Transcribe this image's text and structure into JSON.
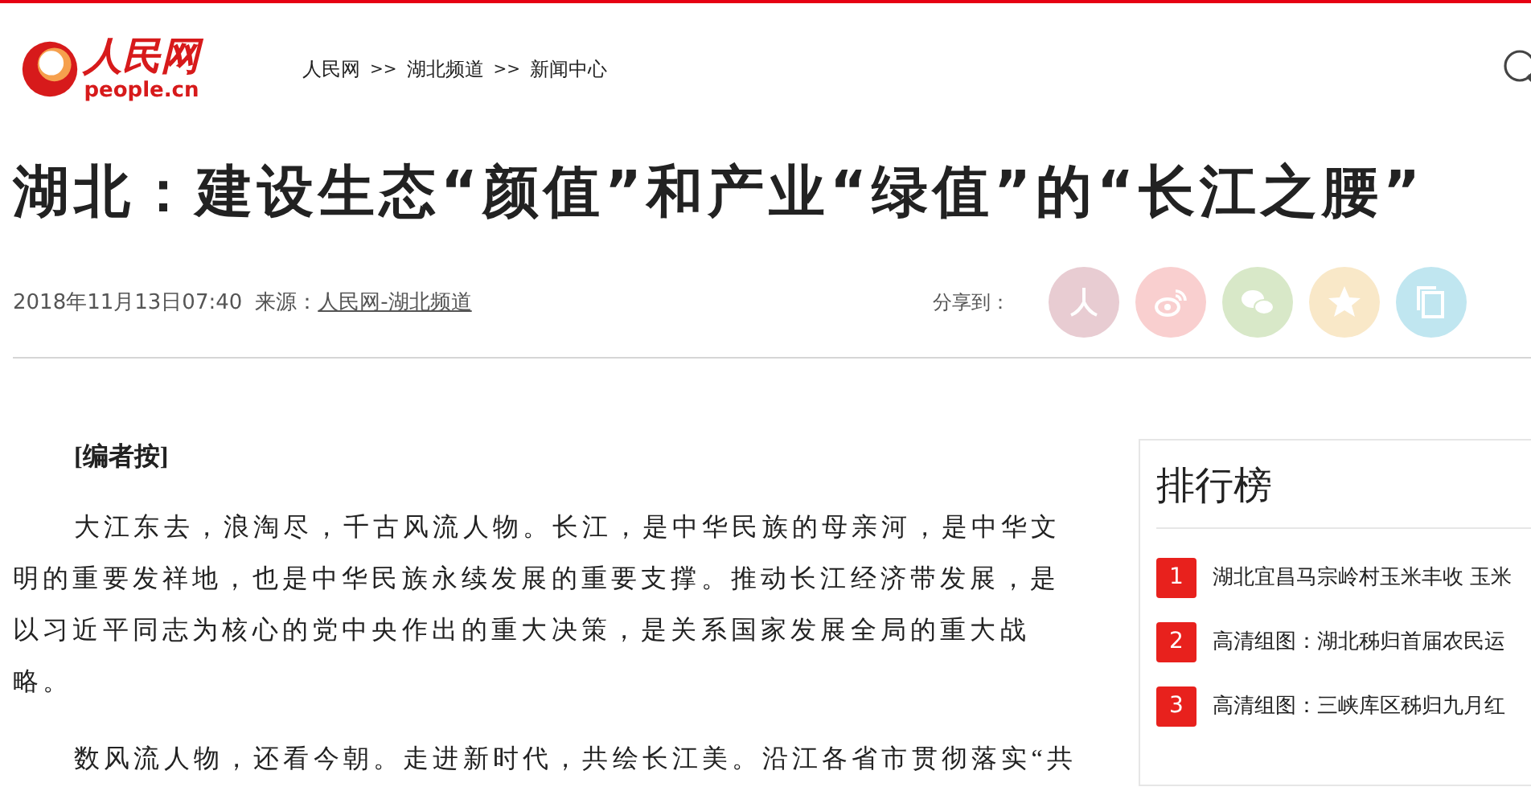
{
  "logo": {
    "name": "人民网",
    "domain": "people.cn"
  },
  "breadcrumb": [
    "人民网",
    "湖北频道",
    "新闻中心"
  ],
  "breadcrumb_separator": ">>",
  "article": {
    "title": "湖北：建设生态“颜值”和产业“绿值”的“长江之腰”",
    "date": "2018年11月13日07:40",
    "source_label": "来源：",
    "source": "人民网-湖北频道",
    "share_label": "分享到：",
    "share_buttons": [
      {
        "kind": "people",
        "color": "#e8ccd2"
      },
      {
        "kind": "weibo",
        "color": "#f9cfcf"
      },
      {
        "kind": "wechat",
        "color": "#d8e8c8"
      },
      {
        "kind": "qzone",
        "color": "#f9e8c8"
      },
      {
        "kind": "copy",
        "color": "#c0e6f0"
      }
    ],
    "editor_note": "[编者按]",
    "paragraphs": [
      "大江东去，浪淘尽，千古风流人物。长江，是中华民族的母亲河，是中华文明的重要发祥地，也是中华民族永续发展的重要支撑。推动长江经济带发展，是以习近平同志为核心的党中央作出的重大决策，是关系国家发展全局的重大战略。",
      "数风流人物，还看今朝。走进新时代，共绘长江美。沿江各省市贯彻落实“共"
    ]
  },
  "ranking": {
    "title": "排行榜",
    "items": [
      {
        "rank": "1",
        "text": "湖北宜昌马宗岭村玉米丰收 玉米"
      },
      {
        "rank": "2",
        "text": "高清组图：湖北秭归首届农民运"
      },
      {
        "rank": "3",
        "text": "高清组图：三峡库区秭归九月红"
      }
    ]
  }
}
